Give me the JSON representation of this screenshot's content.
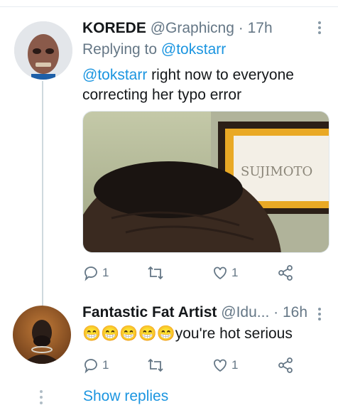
{
  "tweet1": {
    "name": "KOREDE",
    "handle": "@Graphicng",
    "separator": "·",
    "time": "17h",
    "replying_prefix": "Replying to",
    "replying_handle": "@tokstarr",
    "text_mention": "@tokstarr",
    "text_line1": " right now to everyone",
    "text_line2": "correcting her typo error",
    "media_sign_text": "SUJIMOTO",
    "actions": {
      "reply_count": "1",
      "retweet_count": "",
      "like_count": "1"
    }
  },
  "tweet2": {
    "name": "Fantastic Fat Artist",
    "handle": "@Idu...",
    "separator": "·",
    "time": "16h",
    "emojis": "😁😁😁😁😁",
    "text": "you're hot serious",
    "actions": {
      "reply_count": "1",
      "retweet_count": "",
      "like_count": "1"
    }
  },
  "show_replies": "Show replies",
  "colors": {
    "accent": "#1b95e0",
    "secondary": "#657786",
    "thread_line": "#cfd9de"
  }
}
